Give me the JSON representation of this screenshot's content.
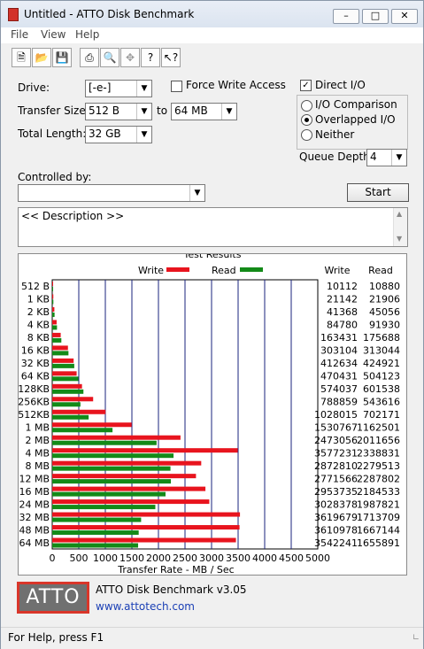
{
  "window": {
    "title": "Untitled - ATTO Disk Benchmark"
  },
  "menu": [
    "File",
    "View",
    "Help"
  ],
  "toolbar_icons": [
    "new-icon",
    "open-icon",
    "save-icon",
    "print-icon",
    "print-preview-icon",
    "move-icon",
    "help-icon",
    "context-help-icon"
  ],
  "form": {
    "drive_label": "Drive:",
    "drive_value": "[-e-]",
    "transfer_size_label": "Transfer Size:",
    "transfer_from": "512 B",
    "to_label": "to",
    "transfer_to": "64 MB",
    "total_length_label": "Total Length:",
    "total_length_value": "32 GB",
    "force_write_label": "Force Write Access",
    "force_write_checked": false,
    "direct_io_label": "Direct I/O",
    "direct_io_checked": true,
    "io_comparison_label": "I/O Comparison",
    "overlapped_io_label": "Overlapped I/O",
    "neither_label": "Neither",
    "selected_mode": "Overlapped I/O",
    "queue_depth_label": "Queue Depth:",
    "queue_depth_value": "4",
    "controlled_by_label": "Controlled by:",
    "controlled_by_value": "",
    "start_label": "Start",
    "description": "<< Description >>"
  },
  "results": {
    "title": "Test Results",
    "legend_write": "Write",
    "legend_read": "Read",
    "col_write": "Write",
    "col_read": "Read",
    "write_color": "#e8141e",
    "read_color": "#138a18",
    "xlabel": "Transfer Rate - MB / Sec"
  },
  "chart_data": {
    "type": "bar",
    "orientation": "horizontal",
    "title": "Test Results",
    "xlabel": "Transfer Rate - MB / Sec",
    "xlim": [
      0,
      5000
    ],
    "xticks": [
      "0",
      "500",
      "1000",
      "1500",
      "2000",
      "2500",
      "3000",
      "3500",
      "4000",
      "4500",
      "5000"
    ],
    "categories": [
      "512 B",
      "1 KB",
      "2 KB",
      "4 KB",
      "8 KB",
      "16 KB",
      "32 KB",
      "64 KB",
      "128KB",
      "256KB",
      "512KB",
      "1 MB",
      "2 MB",
      "4 MB",
      "8 MB",
      "12 MB",
      "16 MB",
      "24 MB",
      "32 MB",
      "48 MB",
      "64 MB"
    ],
    "series": [
      {
        "name": "Write",
        "color": "#e8141e",
        "values": [
          10112,
          21142,
          41368,
          84780,
          163431,
          303104,
          412634,
          470431,
          574037,
          788859,
          1028015,
          1530767,
          2473056,
          3577231,
          2872810,
          2771566,
          2953735,
          3028378,
          3619679,
          3610978,
          3542241
        ],
        "labels": [
          "10112",
          "21142",
          "41368",
          "84780",
          "163431",
          "303104",
          "412634",
          "470431",
          "574037",
          "788859",
          "1028015",
          "1530767",
          "2473056",
          "3577231",
          "2872810",
          "2771566",
          "2953735",
          "3028378",
          "3619679",
          "3610978",
          "3542241"
        ]
      },
      {
        "name": "Read",
        "color": "#138a18",
        "values": [
          10880,
          21906,
          45056,
          91930,
          175688,
          313044,
          424921,
          504123,
          601538,
          543616,
          702171,
          1162501,
          2011656,
          2338831,
          2279513,
          2287802,
          2184533,
          1987821,
          1713709,
          1667144,
          1655891
        ],
        "labels": [
          "10880",
          "21906",
          "45056",
          "91930",
          "175688",
          "313044",
          "424921",
          "504123",
          "601538",
          "543616",
          "702171",
          "1162501",
          "2011656",
          "2338831",
          "2279513",
          "2287802",
          "2184533",
          "1987821",
          "1713709",
          "1667144",
          "1655891"
        ]
      }
    ],
    "grid": true,
    "legend": "top"
  },
  "footer": {
    "logo_text": "ATTO",
    "product": "ATTO Disk Benchmark v3.05",
    "url": "www.attotech.com"
  },
  "status": "For Help, press F1"
}
